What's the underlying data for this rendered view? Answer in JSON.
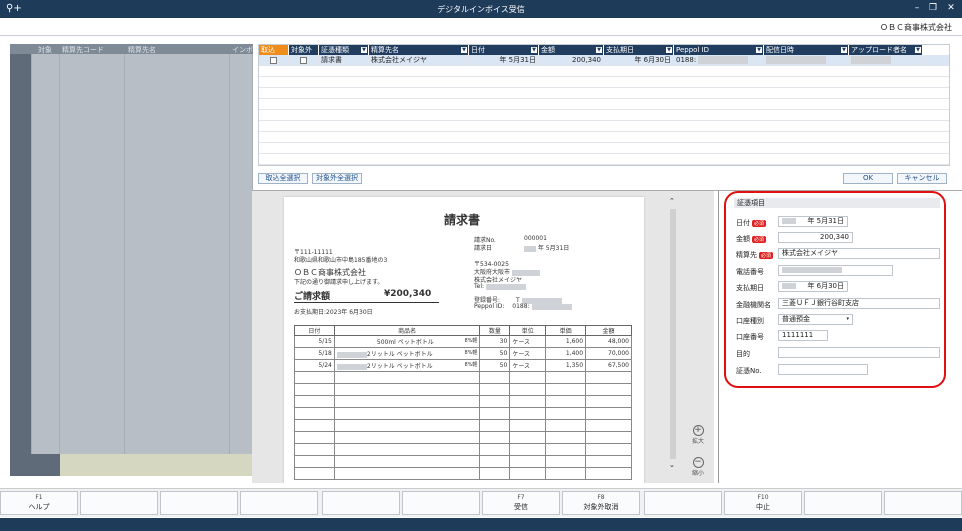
{
  "window": {
    "title": "デジタルインボイス受信",
    "company": "ＯＢＣ商事株式会社"
  },
  "left_panel": {
    "headers": [
      "対象",
      "精算先コード",
      "精算先名",
      "インボ"
    ]
  },
  "grid": {
    "columns": [
      "取込",
      "対象外",
      "証憑種類",
      "精算先名",
      "日付",
      "金額",
      "支払期日",
      "Peppol ID",
      "配信日時",
      "アップロード者名"
    ],
    "rows": [
      {
        "type": "請求書",
        "name": "株式会社メイジヤ",
        "date": "年  5月31日",
        "amount": "200,340",
        "due": "年  6月30日",
        "peppol": "0188:"
      }
    ]
  },
  "buttons": {
    "select_all_import": "取込全選択",
    "select_all_exclude": "対象外全選択",
    "ok": "OK",
    "cancel": "キャンセル"
  },
  "invoice": {
    "title": "請求書",
    "no_label": "請求No.",
    "no": "000001",
    "date_label": "請求日",
    "date": "年 5月31日",
    "to_zip": "〒111-11111",
    "to_addr": "和歌山県和歌山市中島185番地の3",
    "to_company": "ＯＢＣ商事株式会社",
    "greeting": "下記の通り御請求申し上げます。",
    "from_zip": "〒534-0025",
    "from_addr": "大阪府大阪市",
    "from_company": "株式会社メイジヤ",
    "tel": "Tel:",
    "reg_label": "登録番号:",
    "reg": "T",
    "peppol_label": "Peppol ID:",
    "peppol": "0188:",
    "total_label": "ご請求額",
    "total": "¥200,340",
    "due": "お支払期日:2023年 6月30日",
    "table_headers": [
      "日付",
      "商品名",
      "数量",
      "単位",
      "単価",
      "金額"
    ],
    "lines": [
      {
        "date": "5/15",
        "item": "500ml ペットボトル",
        "tax": "8%軽",
        "qty": "30",
        "unit": "ケース",
        "price": "1,600",
        "amount": "48,000"
      },
      {
        "date": "5/18",
        "item": "2リットル ペットボトル",
        "tax": "8%軽",
        "qty": "50",
        "unit": "ケース",
        "price": "1,400",
        "amount": "70,000"
      },
      {
        "date": "5/24",
        "item": "2リットル ペットボトル",
        "tax": "8%軽",
        "qty": "50",
        "unit": "ケース",
        "price": "1,350",
        "amount": "67,500"
      }
    ]
  },
  "zoom": {
    "in": "拡大",
    "out": "縮小"
  },
  "fields": {
    "header": "証憑項目",
    "required": "必須",
    "date_label": "日付",
    "date": "年  5月31日",
    "amount_label": "金額",
    "amount": "200,340",
    "payee_label": "精算先",
    "payee": "株式会社メイジヤ",
    "phone_label": "電話番号",
    "phone": "",
    "due_label": "支払期日",
    "due": "年  6月30日",
    "bank_label": "金融機関名",
    "bank": "三菱ＵＦＪ銀行谷町支店",
    "acct_type_label": "口座種別",
    "acct_type": "普通預金",
    "acct_no_label": "口座番号",
    "acct_no": "1111111",
    "purpose_label": "目的",
    "purpose": "",
    "voucher_label": "証憑No.",
    "voucher": ""
  },
  "fkeys": [
    {
      "key": "F1",
      "label": "ヘルプ"
    },
    {
      "key": "",
      "label": ""
    },
    {
      "key": "",
      "label": ""
    },
    {
      "key": "",
      "label": ""
    },
    {
      "key": "",
      "label": ""
    },
    {
      "key": "",
      "label": ""
    },
    {
      "key": "F7",
      "label": "受信"
    },
    {
      "key": "F8",
      "label": "対象外取消"
    },
    {
      "key": "",
      "label": ""
    },
    {
      "key": "F10",
      "label": "中止"
    },
    {
      "key": "",
      "label": ""
    },
    {
      "key": "",
      "label": ""
    }
  ]
}
